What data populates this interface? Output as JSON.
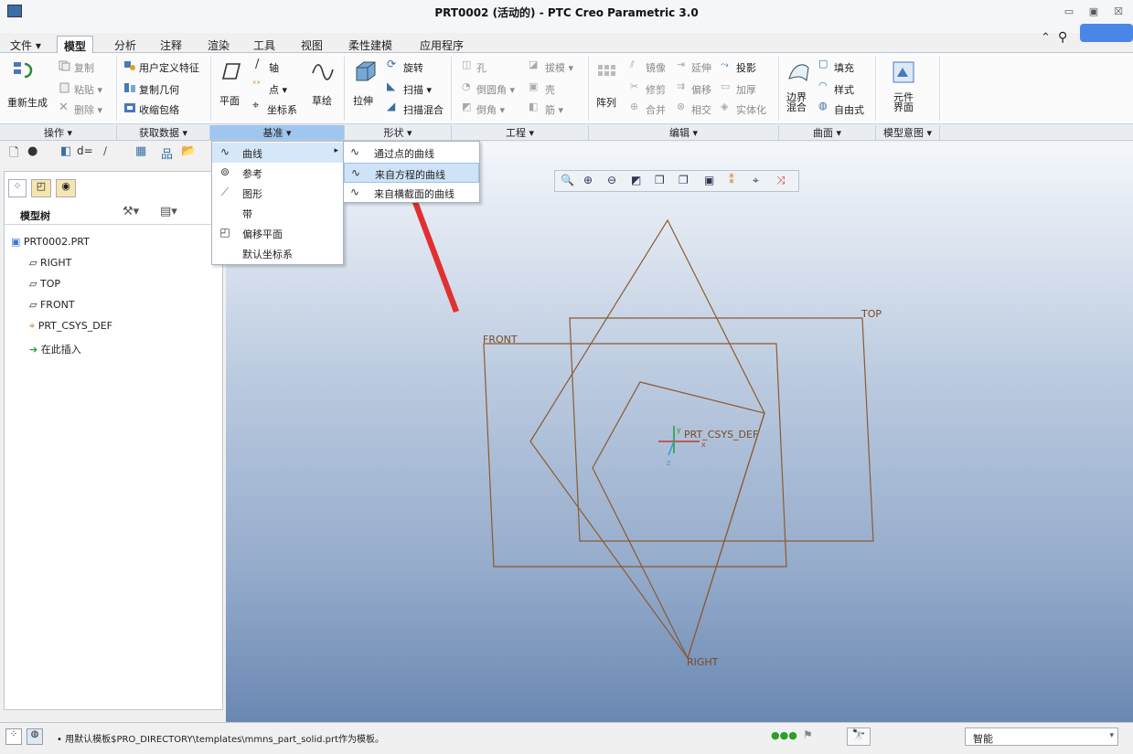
{
  "window": {
    "title": "PRT0002 (活动的) - PTC Creo Parametric 3.0",
    "controls": [
      "▭",
      "▣",
      "☒"
    ]
  },
  "tabs": [
    "文件 ▾",
    "模型",
    "分析",
    "注释",
    "渲染",
    "工具",
    "视图",
    "柔性建模",
    "应用程序"
  ],
  "ribbon": {
    "operations": {
      "regenerate": "重新生成",
      "copy": "复制",
      "paste": "粘贴 ▾",
      "delete": "删除 ▾"
    },
    "get_data": {
      "udf": "用户定义特征",
      "copy_geom": "复制几何",
      "shrinkwrap": "收缩包络"
    },
    "datum": {
      "plane": "平面",
      "axis": "轴",
      "point": "点 ▾",
      "csys": "坐标系",
      "sketch": "草绘"
    },
    "shapes": {
      "extrude": "拉伸",
      "revolve": "旋转",
      "sweep": "扫描 ▾",
      "swept_blend": "扫描混合"
    },
    "engineering": {
      "hole": "孔",
      "draft": "拔模 ▾",
      "round": "倒圆角 ▾",
      "shell": "壳",
      "chamfer": "倒角 ▾",
      "rib": "筋 ▾"
    },
    "editing": {
      "pattern": "阵列",
      "mirror": "镜像",
      "extend": "延伸",
      "project": "投影",
      "trim": "修剪",
      "offset": "偏移",
      "thicken": "加厚",
      "merge": "合并",
      "intersect": "相交",
      "solidify": "实体化"
    },
    "surfaces": {
      "boundary_blend": "边界混合",
      "fill": "填充",
      "style": "样式",
      "freestyle": "自由式"
    },
    "model_intent": {
      "component_interface": "元件界面"
    }
  },
  "groups": [
    "操作 ▾",
    "获取数据 ▾",
    "基准 ▾",
    "形状 ▾",
    "工程 ▾",
    "编辑 ▾",
    "曲面 ▾",
    "模型意图 ▾"
  ],
  "datum_menu": [
    "曲线",
    "参考",
    "图形",
    "带",
    "偏移平面",
    "默认坐标系"
  ],
  "curve_submenu": [
    "通过点的曲线",
    "来自方程的曲线",
    "来自横截面的曲线"
  ],
  "model_tree": {
    "title": "模型树",
    "items": [
      "PRT0002.PRT",
      "RIGHT",
      "TOP",
      "FRONT",
      "PRT_CSYS_DEF",
      "在此插入"
    ]
  },
  "viewport_labels": {
    "top": "TOP",
    "front": "FRONT",
    "right": "RIGHT",
    "csys": "PRT_CSYS_DEF",
    "axis_x": "x",
    "axis_y": "y",
    "axis_z": "z"
  },
  "status": {
    "message": "• 用默认模板$PRO_DIRECTORY\\templates\\mmns_part_solid.prt作为模板。",
    "filter": "智能"
  },
  "colors": {
    "accent": "#9fc6ee",
    "datum_lines": "#8b5a32",
    "highlight": "#d6e7fa"
  }
}
